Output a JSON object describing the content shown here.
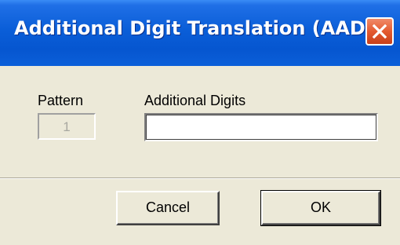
{
  "window": {
    "title": "Additional Digit Translation (AADC)",
    "close_icon": "close-icon"
  },
  "form": {
    "pattern_label": "Pattern",
    "pattern_value": "1",
    "digits_label": "Additional Digits",
    "digits_value": ""
  },
  "buttons": {
    "cancel_label": "Cancel",
    "ok_label": "OK"
  },
  "colors": {
    "titlebar": "#0a5ed8",
    "close_button": "#e45a30",
    "dialog_bg": "#ece9d8"
  }
}
